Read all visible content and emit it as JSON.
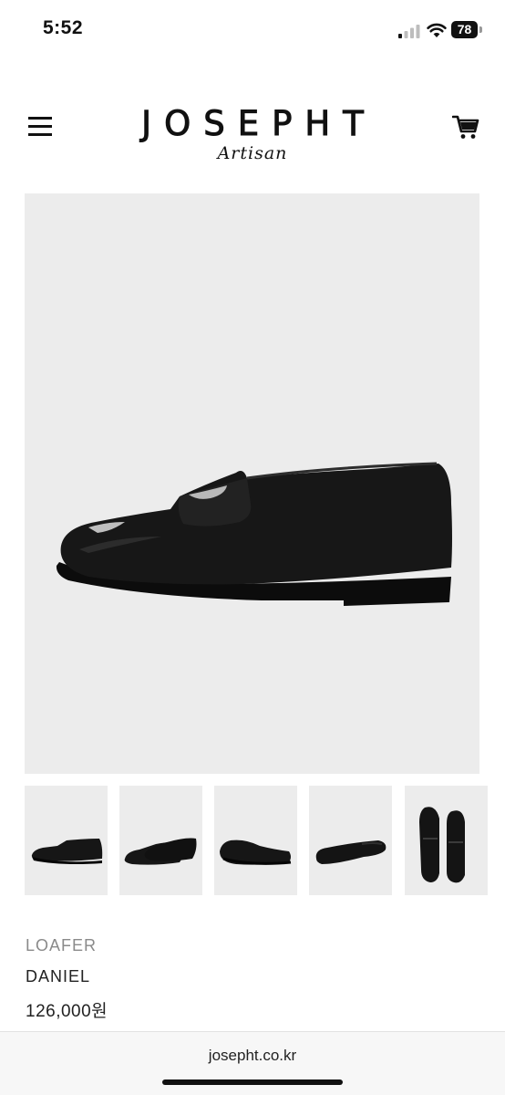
{
  "status_bar": {
    "time": "5:52",
    "battery": "78"
  },
  "header": {
    "brand": "JOSEPHT",
    "brand_sub": "Artisan",
    "menu_icon": "hamburger-menu-icon",
    "cart_icon": "shopping-cart-icon"
  },
  "gallery": {
    "main_image": "black penny loafer side view",
    "thumbnails": [
      {
        "label": "side view"
      },
      {
        "label": "three-quarter view"
      },
      {
        "label": "pair side view"
      },
      {
        "label": "sole view"
      },
      {
        "label": "top view"
      }
    ]
  },
  "product": {
    "category": "LOAFER",
    "name": "DANIEL",
    "price": "126,000원"
  },
  "browser": {
    "url": "josepht.co.kr"
  },
  "colors": {
    "image_background": "#ececec",
    "shoe": "#151515",
    "muted_text": "#8a8a8a"
  }
}
